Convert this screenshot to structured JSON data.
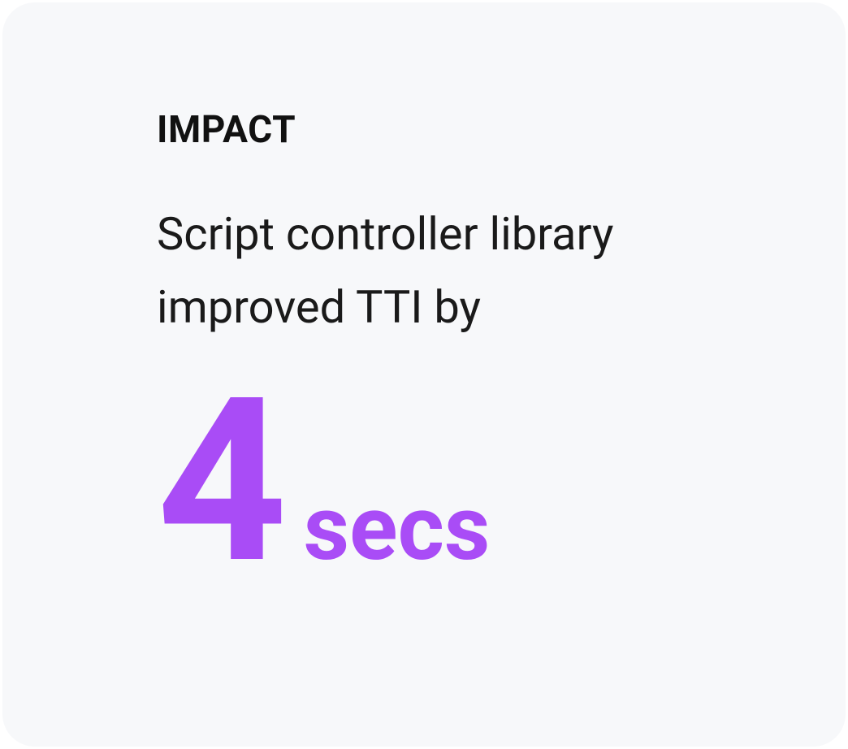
{
  "card": {
    "heading": "IMPACT",
    "description": "Script controller library improved TTI by",
    "stat_value": "4",
    "stat_unit": "secs"
  },
  "colors": {
    "card_bg": "#f7f8fa",
    "accent": "#a94cf6",
    "text": "#111111"
  }
}
